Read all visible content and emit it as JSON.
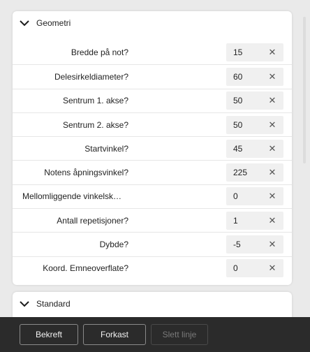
{
  "sections": {
    "geometri": {
      "title": "Geometri",
      "expanded": true,
      "icon": "chevron-down-icon"
    },
    "standard": {
      "title": "Standard",
      "expanded": true,
      "icon": "chevron-down-icon"
    }
  },
  "rows": [
    {
      "label": "Bredde på not?",
      "value": "15"
    },
    {
      "label": "Delesirkeldiameter?",
      "value": "60"
    },
    {
      "label": "Sentrum 1. akse?",
      "value": "50"
    },
    {
      "label": "Sentrum 2. akse?",
      "value": "50"
    },
    {
      "label": "Startvinkel?",
      "value": "45"
    },
    {
      "label": "Notens åpningsvinkel?",
      "value": "225"
    },
    {
      "label": "Mellomliggende vinkelsk…",
      "value": "0"
    },
    {
      "label": "Antall repetisjoner?",
      "value": "1"
    },
    {
      "label": "Dybde?",
      "value": "-5"
    },
    {
      "label": "Koord. Emneoverflate?",
      "value": "0"
    }
  ],
  "clear_symbol": "✕",
  "footer": {
    "confirm_label": "Bekreft",
    "discard_label": "Forkast",
    "delete_line_label": "Slett linje"
  },
  "colors": {
    "background": "#eaeaea",
    "panel": "#ffffff",
    "input": "#f0f0f0",
    "footer": "#2b2b2b",
    "disabled_text": "#7a7a7a"
  }
}
